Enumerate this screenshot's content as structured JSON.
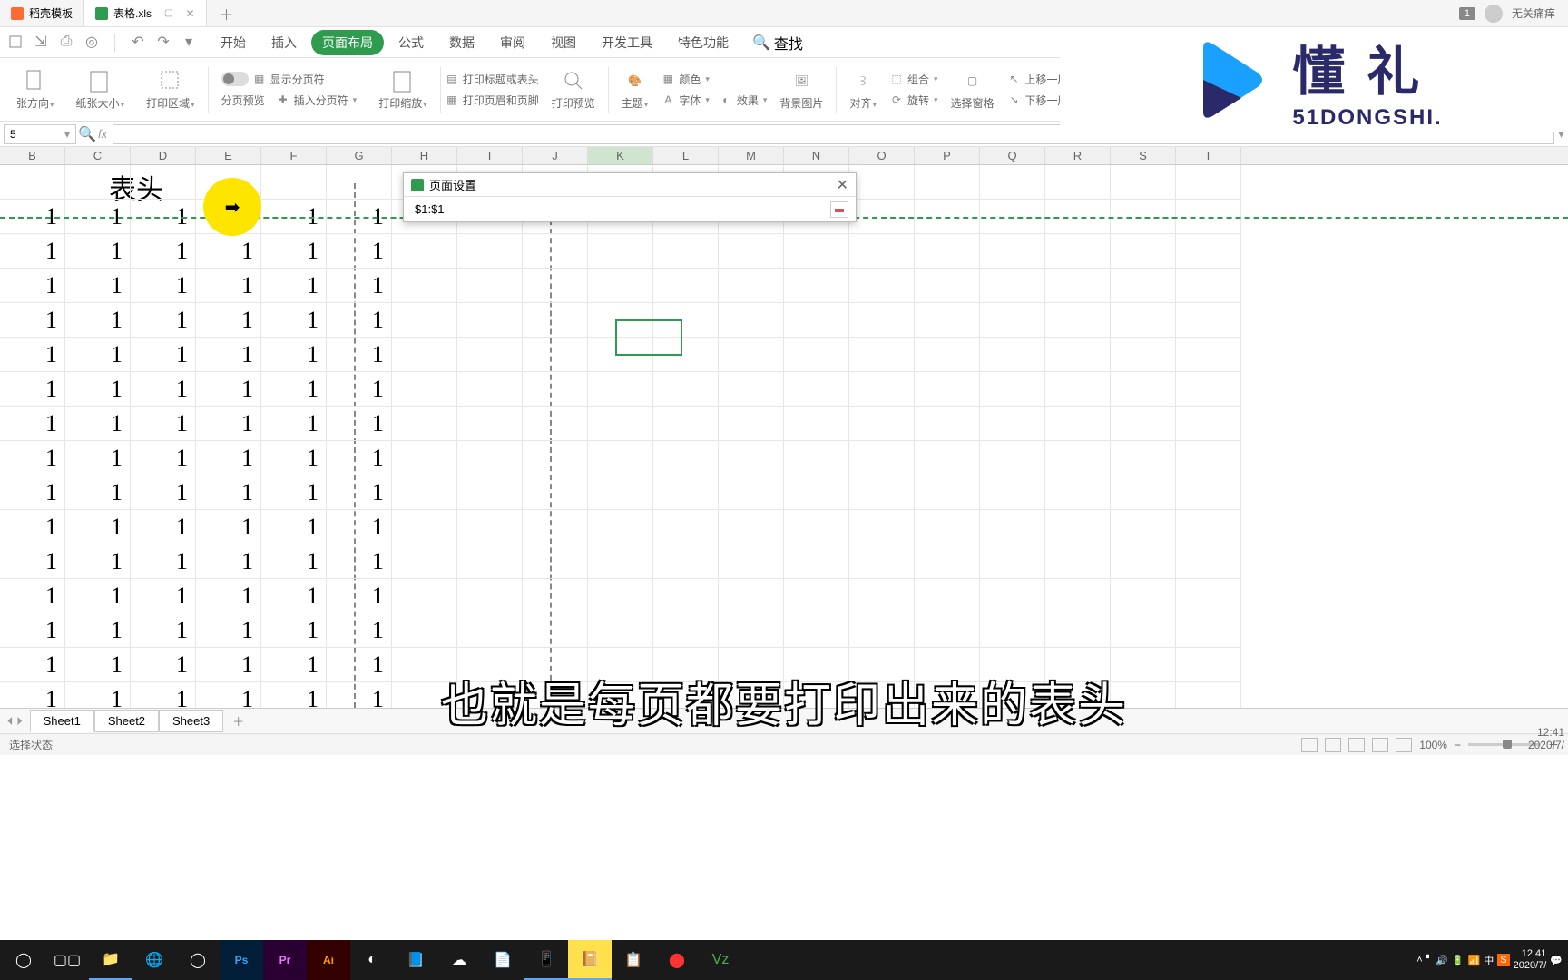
{
  "tabs": {
    "t1": "稻壳模板",
    "t2": "表格.xls"
  },
  "user": {
    "badge": "1",
    "name": "无关痛痒"
  },
  "ribbonTabs": {
    "start": "开始",
    "insert": "插入",
    "layout": "页面布局",
    "formula": "公式",
    "data": "数据",
    "review": "审阅",
    "view": "视图",
    "dev": "开发工具",
    "special": "特色功能",
    "search": "查找"
  },
  "ribbon": {
    "orient": "张方向",
    "size": "纸张大小",
    "area": "打印区域",
    "preview": "分页预览",
    "showBreak": "显示分页符",
    "insertBreak": "插入分页符",
    "printScale": "打印缩放",
    "titleRow": "打印标题或表头",
    "hf": "打印页眉和页脚",
    "printPreview": "打印预览",
    "theme": "主题",
    "color": "颜色",
    "font": "字体",
    "effect": "效果",
    "bgimg": "背景图片",
    "align": "对齐",
    "rotate": "旋转",
    "group": "组合",
    "selpane": "选择窗格",
    "moveUp": "上移一层",
    "moveDown": "下移一层"
  },
  "nameBox": "5",
  "fx": "fx",
  "columns": [
    "B",
    "C",
    "D",
    "E",
    "F",
    "G",
    "H",
    "I",
    "J",
    "K",
    "L",
    "M",
    "N",
    "O",
    "P",
    "Q",
    "R",
    "S",
    "T"
  ],
  "activeCol": "K",
  "headerText": "表头",
  "cellValue": "1",
  "dialog": {
    "title": "页面设置",
    "value": "$1:$1"
  },
  "sheets": [
    "Sheet1",
    "Sheet2",
    "Sheet3"
  ],
  "status": {
    "left": "选择状态",
    "zoom": "100%"
  },
  "caption": "也就是每页都要打印出来的表头",
  "watermark": {
    "title": "懂 礼",
    "sub": "51DONGSHI."
  },
  "clock": {
    "time": "12:41",
    "date": "2020/7/"
  },
  "tbTray": {
    "ime": "中"
  }
}
